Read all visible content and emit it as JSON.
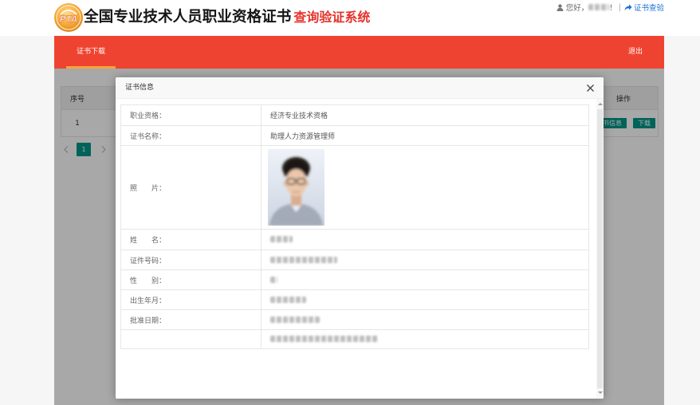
{
  "header": {
    "logo": {
      "text": "PTA",
      "icon": "pta-logo"
    },
    "title_main": "全国专业技术人员职业资格证书",
    "title_sub": "查询验证系统",
    "user": {
      "icon": "user-icon",
      "greeting": "您好，",
      "greeting_end": "！",
      "separator": "|"
    },
    "verify_link": {
      "icon": "share-arrow-icon",
      "label": "证书查验"
    }
  },
  "nav": {
    "tabs": [
      {
        "label": "证书下载",
        "active": true
      }
    ],
    "logout_label": "退出"
  },
  "certificate_list": {
    "columns": {
      "index": "序号",
      "actions": "操作"
    },
    "rows": [
      {
        "index": "1",
        "info_button": "证书信息",
        "download_button": "下载"
      }
    ],
    "pagination": {
      "current_page": "1",
      "prev_icon": "chevron-left-icon",
      "next_icon": "chevron-right-icon"
    }
  },
  "modal": {
    "title": "证书信息",
    "close_icon": "close-icon",
    "rows": [
      {
        "label": "职业资格：",
        "value": "经济专业技术资格"
      },
      {
        "label": "证书名称：",
        "value": "助理人力资源管理师"
      },
      {
        "label": "照　　片："
      },
      {
        "label": "姓　　名："
      },
      {
        "label": "证件号码："
      },
      {
        "label": "性　　别："
      },
      {
        "label": "出生年月："
      },
      {
        "label": "批准日期："
      },
      {
        "label": ""
      }
    ]
  },
  "colors": {
    "nav_red": "#ef4331",
    "title_red": "#e5322b",
    "tab_underline": "#f6a33a",
    "link_blue": "#1f6fd6",
    "button_green": "#009688",
    "logo_gold": "#f5ab3a"
  }
}
